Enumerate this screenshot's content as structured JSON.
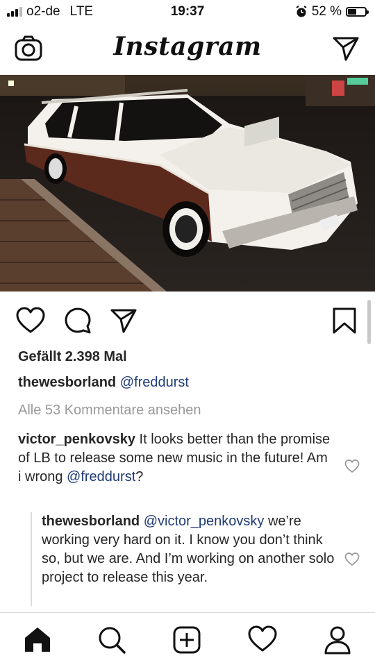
{
  "status_bar": {
    "carrier": "o2-de",
    "network": "LTE",
    "time": "19:37",
    "battery": "52 %",
    "battery_level": 0.52
  },
  "header": {
    "logo": "Instagram",
    "left_icon": "camera-icon",
    "right_icon": "direct-message-icon"
  },
  "post": {
    "image_alt": "white station wagon with wood paneling parked on street at night",
    "likes": "Gefällt 2.398 Mal",
    "caption_user": "thewesborland",
    "caption_text": "@freddurst",
    "view_all_comments": "Alle 53 Kommentare ansehen"
  },
  "comments": [
    {
      "user": "victor_penkovsky",
      "text": "It looks better than the promise of LB to release some new music in the future! Am i wrong ",
      "mention": "@freddurst",
      "suffix": "?"
    }
  ],
  "replies": [
    {
      "user": "thewesborland",
      "mention": "@victor_penkovsky",
      "text": "we’re working very hard on it. I know you don’t think so, but we are. And I’m working on another solo project to release this year."
    }
  ],
  "tab_bar": {
    "items": [
      "home-icon",
      "search-icon",
      "add-post-icon",
      "activity-heart-icon",
      "profile-icon"
    ]
  },
  "colors": {
    "text": "#262626",
    "muted": "#999999",
    "mention": "#1f3a75",
    "divider": "#dbdbdb"
  }
}
